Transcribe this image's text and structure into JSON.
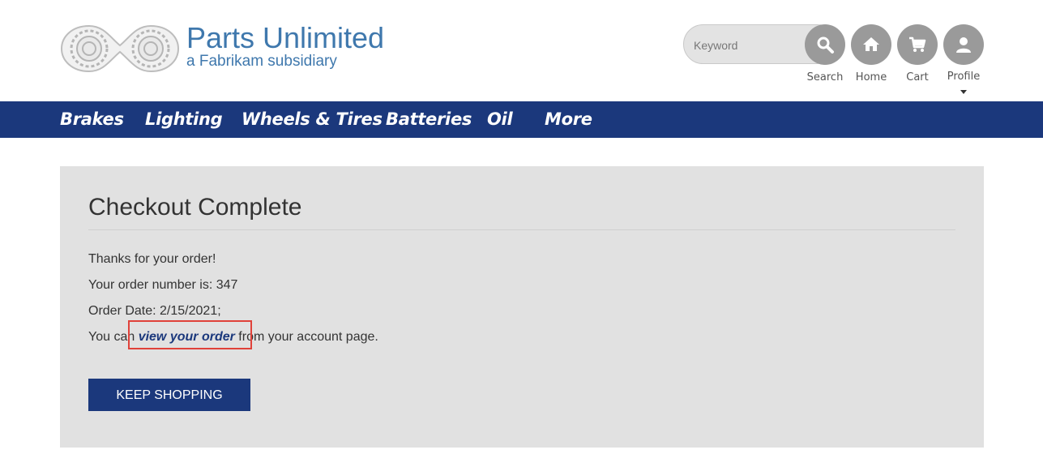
{
  "header": {
    "brand_name": "Parts Unlimited",
    "brand_subtitle": "a Fabrikam subsidiary",
    "search": {
      "placeholder": "Keyword",
      "value": "",
      "button_label": "Search"
    },
    "nav_buttons": {
      "home": "Home",
      "cart": "Cart",
      "profile": "Profile"
    }
  },
  "nav": {
    "items": [
      "Brakes",
      "Lighting",
      "Wheels & Tires",
      "Batteries",
      "Oil",
      "More"
    ]
  },
  "main": {
    "title": "Checkout Complete",
    "thanks": "Thanks for your order!",
    "order_number_label": "Your order number is: 347",
    "order_date_label": "Order Date: 2/15/2021;",
    "view_prefix": "You can ",
    "view_link": "view your order",
    "view_suffix": " from your account page.",
    "keep_shopping": "KEEP SHOPPING"
  },
  "colors": {
    "brand_blue": "#3f78ad",
    "nav_bg": "#1b387c",
    "panel_bg": "#e1e1e1",
    "icon_gray": "#9a9a9a",
    "highlight": "#e0423a"
  },
  "icons": [
    "gear-logo-icon",
    "search-icon",
    "home-icon",
    "cart-icon",
    "user-icon",
    "caret-down-icon"
  ]
}
